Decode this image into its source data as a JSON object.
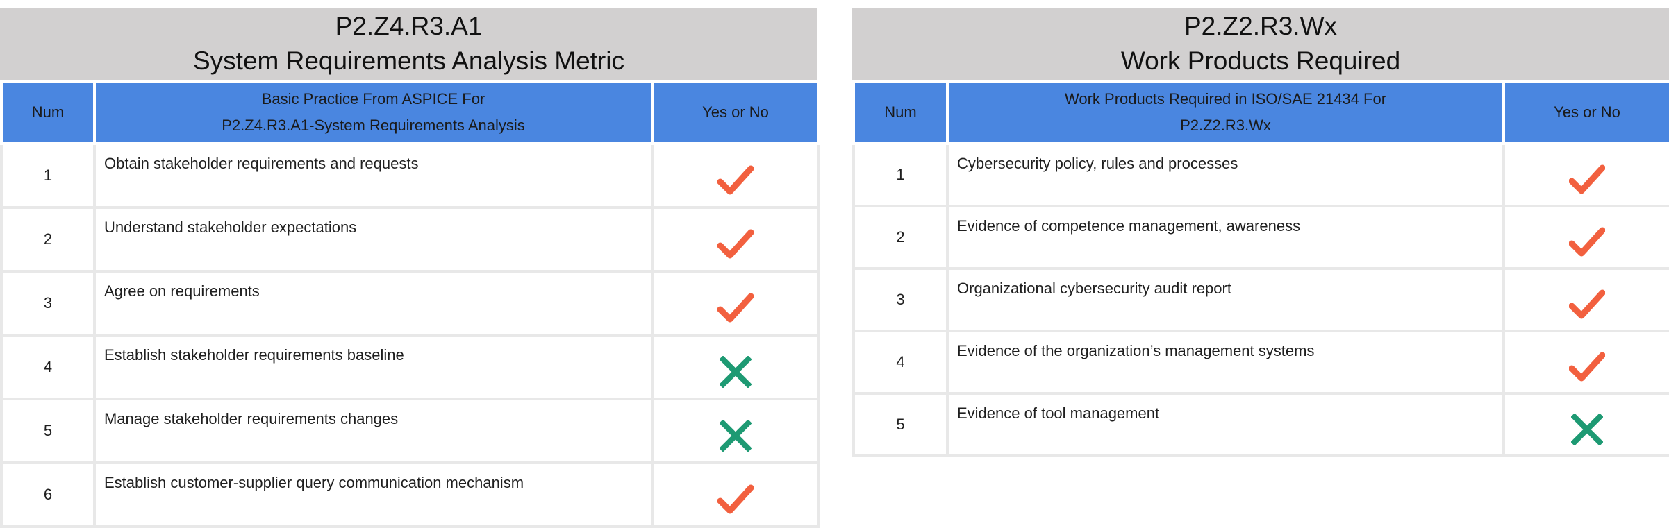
{
  "left_table": {
    "title_line1": "P2.Z4.R3.A1",
    "title_line2": "System Requirements Analysis Metric",
    "header": {
      "num": "Num",
      "practice_line1": "Basic Practice From ASPICE For",
      "practice_line2": "P2.Z4.R3.A1-System Requirements Analysis",
      "yes_no": "Yes or No"
    },
    "rows": [
      {
        "num": "1",
        "text": "Obtain stakeholder requirements and requests",
        "status": "yes"
      },
      {
        "num": "2",
        "text": "Understand stakeholder expectations",
        "status": "yes"
      },
      {
        "num": "3",
        "text": "Agree on requirements",
        "status": "yes"
      },
      {
        "num": "4",
        "text": "Establish stakeholder requirements baseline",
        "status": "no"
      },
      {
        "num": "5",
        "text": "Manage stakeholder requirements changes",
        "status": "no"
      },
      {
        "num": "6",
        "text": "Establish customer-supplier query communication mechanism",
        "status": "yes"
      }
    ]
  },
  "right_table": {
    "title_line1": "P2.Z2.R3.Wx",
    "title_line2": "Work Products Required",
    "header": {
      "num": "Num",
      "practice_line1": "Work Products Required in  ISO/SAE 21434 For",
      "practice_line2": "P2.Z2.R3.Wx",
      "yes_no": "Yes or No"
    },
    "rows": [
      {
        "num": "1",
        "text": "Cybersecurity policy, rules and processes",
        "status": "yes"
      },
      {
        "num": "2",
        "text": "Evidence of competence management, awareness",
        "status": "yes"
      },
      {
        "num": "3",
        "text": "Organizational cybersecurity audit report",
        "status": "yes"
      },
      {
        "num": "4",
        "text": "Evidence of the organization’s management systems",
        "status": "yes"
      },
      {
        "num": "5",
        "text": "Evidence of tool management",
        "status": "no"
      }
    ]
  },
  "icons": {
    "yes": {
      "name": "check-icon",
      "color": "#f2603f"
    },
    "no": {
      "name": "cross-icon",
      "color": "#1e9a73"
    }
  }
}
